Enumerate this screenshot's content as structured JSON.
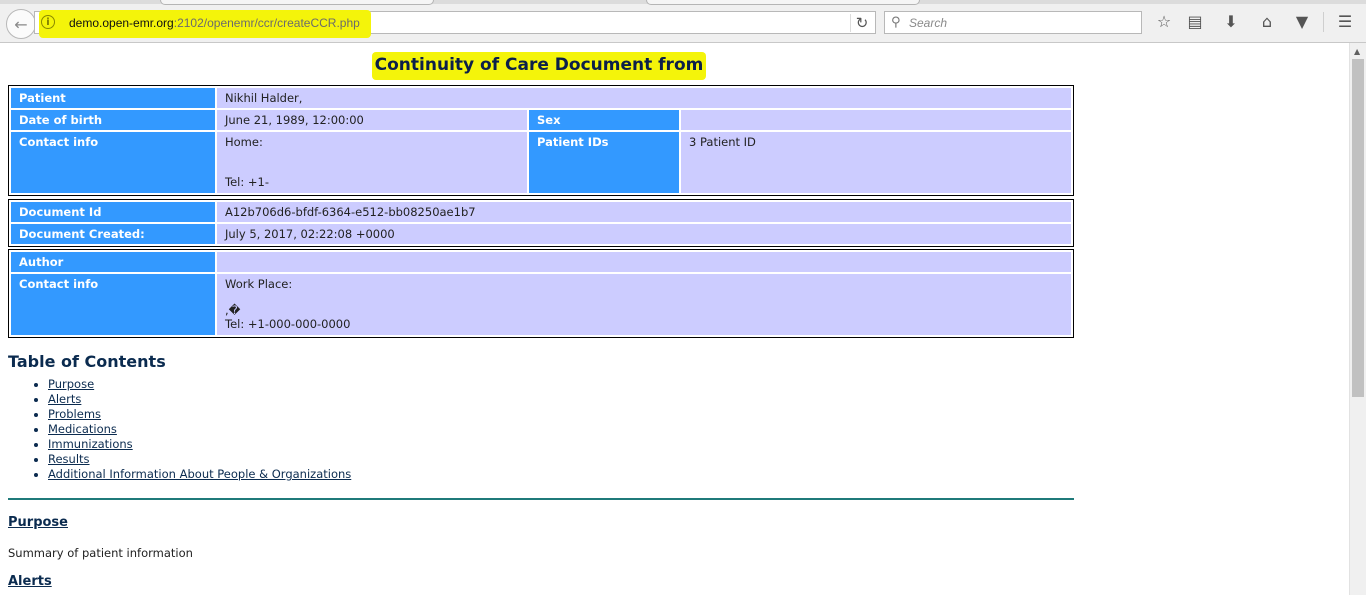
{
  "browser": {
    "url_domain": "demo.open-emr.org",
    "url_rest": ":2102/openemr/ccr/createCCR.php",
    "search_placeholder": "Search"
  },
  "document": {
    "title": "Continuity of Care Document from",
    "patient": {
      "patient_label": "Patient",
      "patient_value": "Nikhil Halder,",
      "dob_label": "Date of birth",
      "dob_value": "June 21, 1989, 12:00:00",
      "sex_label": "Sex",
      "sex_value": "",
      "contact_label": "Contact info",
      "contact_home": "Home:",
      "contact_tel": "Tel: +1-",
      "ids_label": "Patient IDs",
      "ids_value": "3 Patient ID"
    },
    "meta": {
      "docid_label": "Document Id",
      "docid_value": "A12b706d6-bfdf-6364-e512-bb08250ae1b7",
      "created_label": "Document Created:",
      "created_value": "July 5, 2017, 02:22:08 +0000"
    },
    "author": {
      "author_label": "Author",
      "author_value": "",
      "contact_label": "Contact info",
      "work_place": "Work Place:",
      "garbled": ",�",
      "tel": "Tel: +1-000-000-0000"
    },
    "toc": {
      "heading": "Table of Contents",
      "items": [
        "Purpose",
        "Alerts",
        "Problems",
        "Medications",
        "Immunizations",
        "Results",
        "Additional Information About People & Organizations"
      ]
    },
    "sections": {
      "purpose_heading": "Purpose",
      "purpose_text": "Summary of patient information",
      "alerts_heading": "Alerts"
    }
  },
  "colors": {
    "label_bg": "#3399ff",
    "value_bg": "#ccccff",
    "highlight": "#f4f40a",
    "rule": "#1f7a7a"
  },
  "icons": [
    "info-icon",
    "back-icon",
    "reload-icon",
    "search-icon",
    "star-icon",
    "reading-list-icon",
    "download-icon",
    "home-icon",
    "pocket-icon",
    "menu-icon"
  ]
}
